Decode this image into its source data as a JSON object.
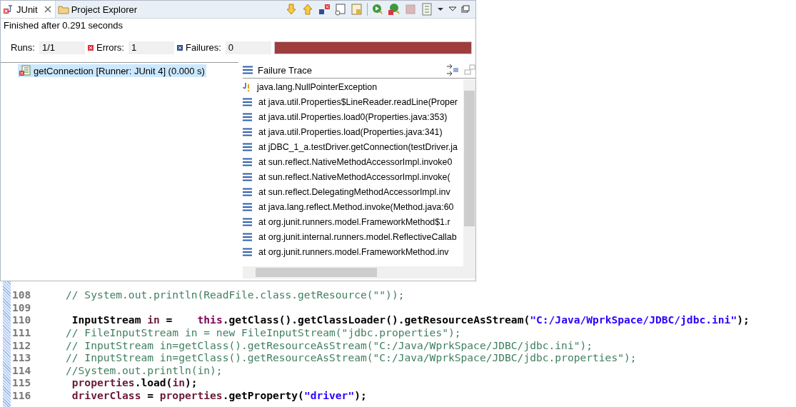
{
  "junit_view": {
    "tabs": [
      {
        "label": "JUnit",
        "kind": "junit",
        "selected": true
      },
      {
        "label": "Project Explorer",
        "kind": "explorer",
        "selected": false
      }
    ],
    "status": "Finished after 0.291 seconds",
    "counters": [
      {
        "label": "Runs:",
        "kind": "runs",
        "value": "1/1"
      },
      {
        "label": "Errors:",
        "kind": "errors",
        "value": "1"
      },
      {
        "label": "Failures:",
        "kind": "failures",
        "value": "0"
      }
    ],
    "progress": {
      "level": 1,
      "failed": true
    },
    "tests": [
      {
        "label": "getConnection [Runner: JUnit 4] (0.000 s)",
        "selected": true
      }
    ],
    "failure_trace": {
      "title": "Failure Trace",
      "lines": [
        {
          "kind": "exception",
          "text": "java.lang.NullPointerException"
        },
        {
          "kind": "frame",
          "text": "at java.util.Properties$LineReader.readLine(Proper"
        },
        {
          "kind": "frame",
          "text": "at java.util.Properties.load0(Properties.java:353)"
        },
        {
          "kind": "frame",
          "text": "at java.util.Properties.load(Properties.java:341)"
        },
        {
          "kind": "frame",
          "text": "at jDBC_1_a.testDriver.getConnection(testDriver.ja"
        },
        {
          "kind": "frame",
          "text": "at sun.reflect.NativeMethodAccessorImpl.invoke0"
        },
        {
          "kind": "frame",
          "text": "at sun.reflect.NativeMethodAccessorImpl.invoke("
        },
        {
          "kind": "frame",
          "text": "at sun.reflect.DelegatingMethodAccessorImpl.inv"
        },
        {
          "kind": "frame",
          "text": "at java.lang.reflect.Method.invoke(Method.java:60"
        },
        {
          "kind": "frame",
          "text": "at org.junit.runners.model.FrameworkMethod$1.r"
        },
        {
          "kind": "frame",
          "text": "at org.junit.internal.runners.model.ReflectiveCallab"
        },
        {
          "kind": "frame",
          "text": "at org.junit.runners.model.FrameworkMethod.inv"
        }
      ]
    }
  },
  "editor": {
    "lines": [
      {
        "number": "108",
        "tokens": [
          {
            "kind": "comment",
            "text": "// System.out.println(ReadFile.class.getResource(\"\"));"
          }
        ]
      },
      {
        "number": "109"
      },
      {
        "number": "110",
        "tokens": [
          {
            "kind": "plain",
            "text": " InputStream "
          },
          {
            "kind": "field",
            "text": "in"
          },
          {
            "kind": "plain",
            "text": " =    "
          },
          {
            "kind": "keyword",
            "text": "this"
          },
          {
            "kind": "plain",
            "text": ".getClass().getClassLoader().getResourceAsStream("
          },
          {
            "kind": "string",
            "text": "\"C:/Java/WprkSpace/JDBC/jdbc.ini\""
          },
          {
            "kind": "plain",
            "text": ");"
          }
        ]
      },
      {
        "number": "111",
        "tokens": [
          {
            "kind": "comment",
            "text": "// FileInputStream in = new FileInputStream(\"jdbc.properties\");"
          }
        ]
      },
      {
        "number": "112",
        "tokens": [
          {
            "kind": "comment",
            "text": "// InputStream in=getClass().getResourceAsStream(\"C:/Java/WprkSpace/JDBC/jdbc.ini\");"
          }
        ]
      },
      {
        "number": "113",
        "tokens": [
          {
            "kind": "comment",
            "text": "// InputStream in=getClass().getResourceAsStream(\"C:/Java/WprkSpace/JDBC/jdbc.properties\");"
          }
        ]
      },
      {
        "number": "114",
        "tokens": [
          {
            "kind": "comment",
            "text": "//System.out.println(in);"
          }
        ]
      },
      {
        "number": "115",
        "tokens": [
          {
            "kind": "field",
            "text": " properties"
          },
          {
            "kind": "plain",
            "text": ".load("
          },
          {
            "kind": "field",
            "text": "in"
          },
          {
            "kind": "plain",
            "text": ");"
          }
        ]
      },
      {
        "number": "116",
        "tokens": [
          {
            "kind": "field",
            "text": " driverClass"
          },
          {
            "kind": "plain",
            "text": " = "
          },
          {
            "kind": "field",
            "text": "properties"
          },
          {
            "kind": "plain",
            "text": ".getProperty("
          },
          {
            "kind": "string",
            "text": "\"driver\""
          },
          {
            "kind": "plain",
            "text": ");"
          }
        ]
      }
    ]
  }
}
